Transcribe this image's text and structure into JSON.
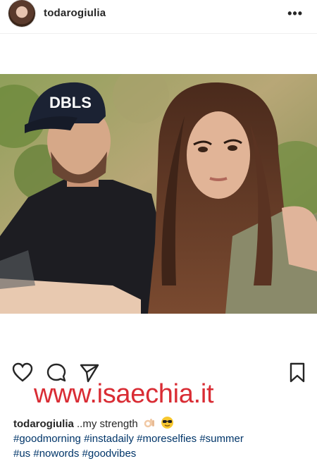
{
  "header": {
    "username": "todarogiulia",
    "more_label": "•••"
  },
  "post": {
    "image_description_icon": "photo",
    "cap_text": "DBLS"
  },
  "actions": {
    "like_icon": "heart-icon",
    "comment_icon": "comment-icon",
    "share_icon": "share-icon",
    "save_icon": "bookmark-icon"
  },
  "watermark": {
    "text": "www.isaechia.it",
    "color": "#d92c34"
  },
  "caption": {
    "username": "todarogiulia",
    "text": "..my strength",
    "hashtags_line1": "#goodmorning #instadaily #moreselfies #summer",
    "hashtags_line2": "#us #nowords #goodvibes"
  }
}
